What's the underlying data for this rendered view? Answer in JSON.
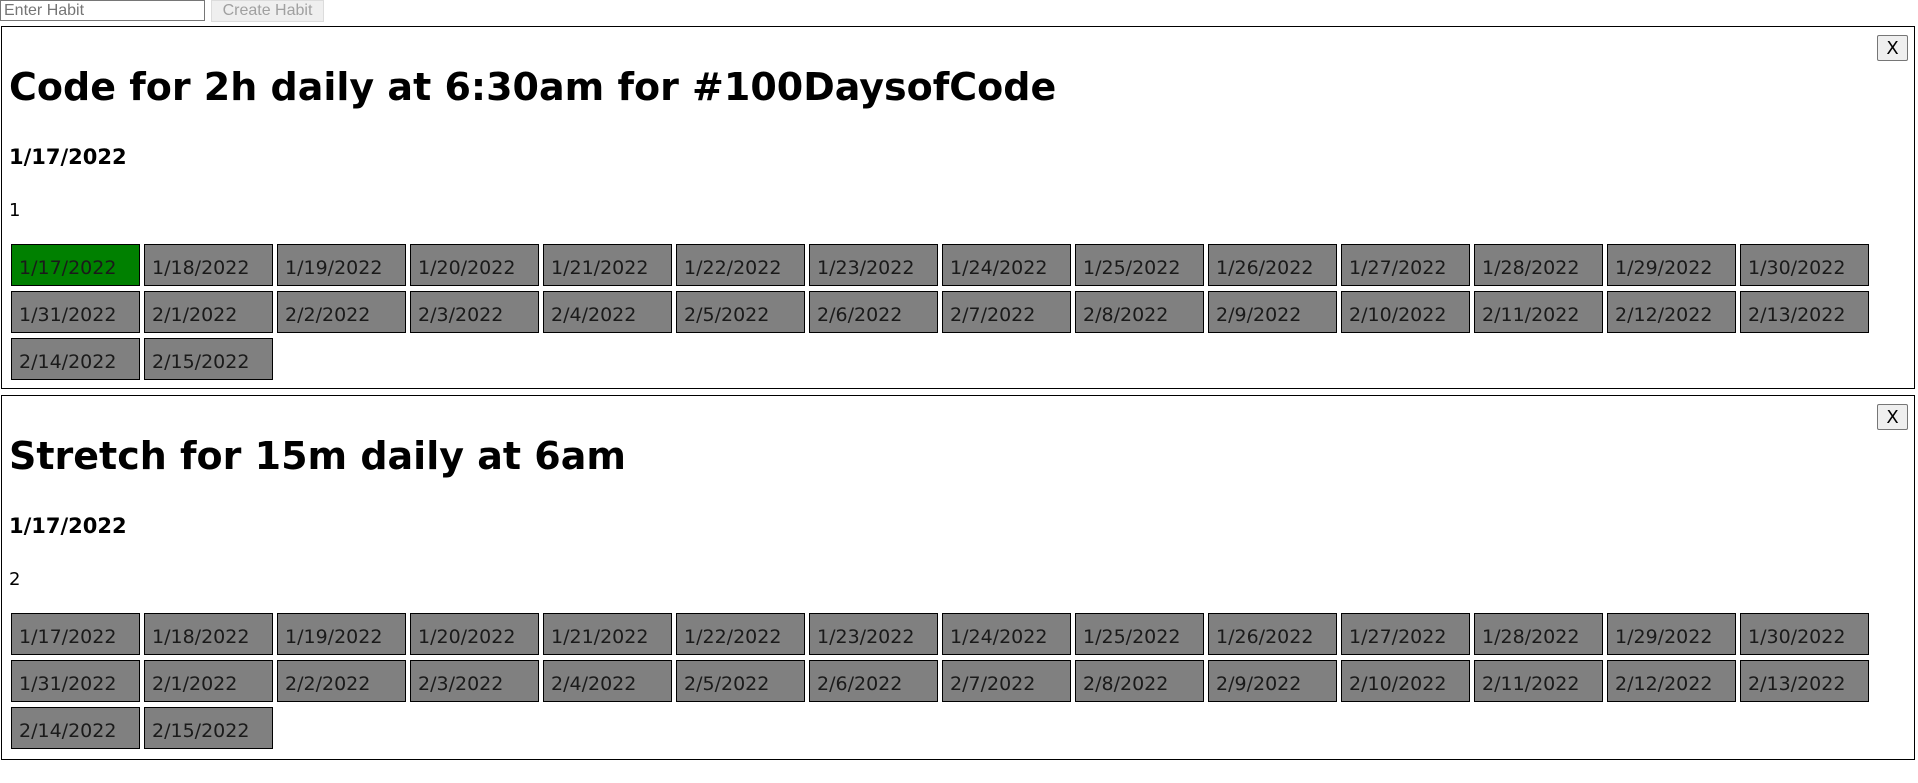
{
  "form": {
    "placeholder": "Enter Habit",
    "create_label": "Create Habit"
  },
  "close_label": "X",
  "colors": {
    "completed": "#008000",
    "pending": "#808080"
  },
  "habits": [
    {
      "title": "Code for 2h daily at 6:30am for #100DaysofCode",
      "start_date": "1/17/2022",
      "count": "1",
      "days": [
        {
          "date": "1/17/2022",
          "done": true
        },
        {
          "date": "1/18/2022",
          "done": false
        },
        {
          "date": "1/19/2022",
          "done": false
        },
        {
          "date": "1/20/2022",
          "done": false
        },
        {
          "date": "1/21/2022",
          "done": false
        },
        {
          "date": "1/22/2022",
          "done": false
        },
        {
          "date": "1/23/2022",
          "done": false
        },
        {
          "date": "1/24/2022",
          "done": false
        },
        {
          "date": "1/25/2022",
          "done": false
        },
        {
          "date": "1/26/2022",
          "done": false
        },
        {
          "date": "1/27/2022",
          "done": false
        },
        {
          "date": "1/28/2022",
          "done": false
        },
        {
          "date": "1/29/2022",
          "done": false
        },
        {
          "date": "1/30/2022",
          "done": false
        },
        {
          "date": "1/31/2022",
          "done": false
        },
        {
          "date": "2/1/2022",
          "done": false
        },
        {
          "date": "2/2/2022",
          "done": false
        },
        {
          "date": "2/3/2022",
          "done": false
        },
        {
          "date": "2/4/2022",
          "done": false
        },
        {
          "date": "2/5/2022",
          "done": false
        },
        {
          "date": "2/6/2022",
          "done": false
        },
        {
          "date": "2/7/2022",
          "done": false
        },
        {
          "date": "2/8/2022",
          "done": false
        },
        {
          "date": "2/9/2022",
          "done": false
        },
        {
          "date": "2/10/2022",
          "done": false
        },
        {
          "date": "2/11/2022",
          "done": false
        },
        {
          "date": "2/12/2022",
          "done": false
        },
        {
          "date": "2/13/2022",
          "done": false
        },
        {
          "date": "2/14/2022",
          "done": false
        },
        {
          "date": "2/15/2022",
          "done": false
        }
      ]
    },
    {
      "title": "Stretch for 15m daily at 6am",
      "start_date": "1/17/2022",
      "count": "2",
      "days": [
        {
          "date": "1/17/2022",
          "done": false
        },
        {
          "date": "1/18/2022",
          "done": false
        },
        {
          "date": "1/19/2022",
          "done": false
        },
        {
          "date": "1/20/2022",
          "done": false
        },
        {
          "date": "1/21/2022",
          "done": false
        },
        {
          "date": "1/22/2022",
          "done": false
        },
        {
          "date": "1/23/2022",
          "done": false
        },
        {
          "date": "1/24/2022",
          "done": false
        },
        {
          "date": "1/25/2022",
          "done": false
        },
        {
          "date": "1/26/2022",
          "done": false
        },
        {
          "date": "1/27/2022",
          "done": false
        },
        {
          "date": "1/28/2022",
          "done": false
        },
        {
          "date": "1/29/2022",
          "done": false
        },
        {
          "date": "1/30/2022",
          "done": false
        },
        {
          "date": "1/31/2022",
          "done": false
        },
        {
          "date": "2/1/2022",
          "done": false
        },
        {
          "date": "2/2/2022",
          "done": false
        },
        {
          "date": "2/3/2022",
          "done": false
        },
        {
          "date": "2/4/2022",
          "done": false
        },
        {
          "date": "2/5/2022",
          "done": false
        },
        {
          "date": "2/6/2022",
          "done": false
        },
        {
          "date": "2/7/2022",
          "done": false
        },
        {
          "date": "2/8/2022",
          "done": false
        },
        {
          "date": "2/9/2022",
          "done": false
        },
        {
          "date": "2/10/2022",
          "done": false
        },
        {
          "date": "2/11/2022",
          "done": false
        },
        {
          "date": "2/12/2022",
          "done": false
        },
        {
          "date": "2/13/2022",
          "done": false
        },
        {
          "date": "2/14/2022",
          "done": false
        },
        {
          "date": "2/15/2022",
          "done": false
        }
      ]
    }
  ]
}
